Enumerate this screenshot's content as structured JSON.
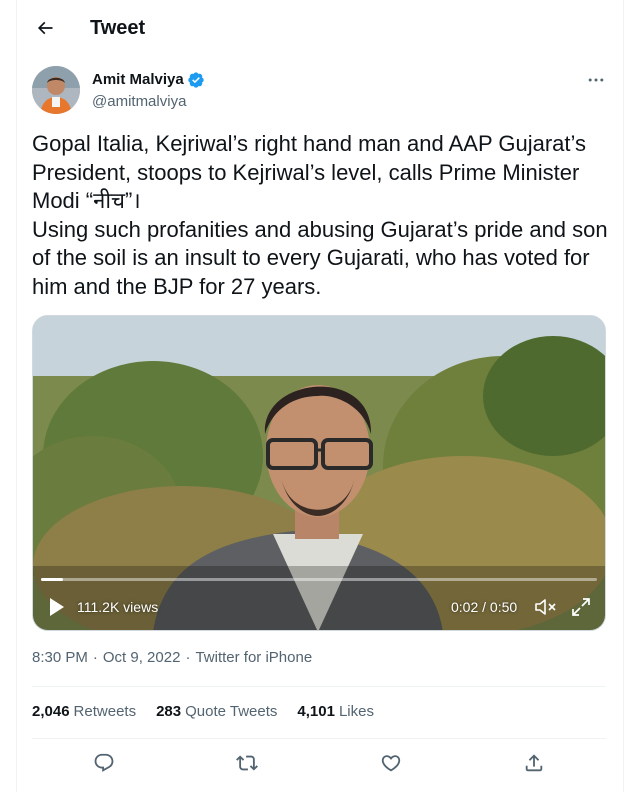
{
  "header": {
    "title": "Tweet"
  },
  "author": {
    "name": "Amit Malviya",
    "handle": "@amitmalviya",
    "verified": true
  },
  "tweet": {
    "text": "Gopal Italia, Kejriwal’s right hand man and AAP Gujarat’s President, stoops to Kejriwal’s level, calls Prime Minister Modi “नीच”।\nUsing such profanities and abusing Gujarat’s pride and son of the soil is an insult to every Gujarati, who has voted for him and the BJP for 27 years."
  },
  "video": {
    "views": "111.2K views",
    "time": "0:02 / 0:50",
    "progress": 0.04
  },
  "meta": {
    "time": "8:30 PM",
    "separator": "·",
    "date": "Oct 9, 2022",
    "source": "Twitter for iPhone"
  },
  "stats": [
    {
      "count": "2,046",
      "label": "Retweets"
    },
    {
      "count": "283",
      "label": "Quote Tweets"
    },
    {
      "count": "4,101",
      "label": "Likes"
    }
  ],
  "icons": {
    "back": "arrow-left-icon",
    "verified": "verified-badge-icon",
    "more": "more-horizontal-icon",
    "play": "play-icon",
    "mute": "volume-muted-icon",
    "fullscreen": "fullscreen-icon",
    "reply": "reply-icon",
    "retweet": "retweet-icon",
    "like": "heart-icon",
    "share": "share-icon"
  },
  "colors": {
    "verified": "#1d9bf0",
    "text": "#0f1419",
    "secondary": "#536471"
  }
}
